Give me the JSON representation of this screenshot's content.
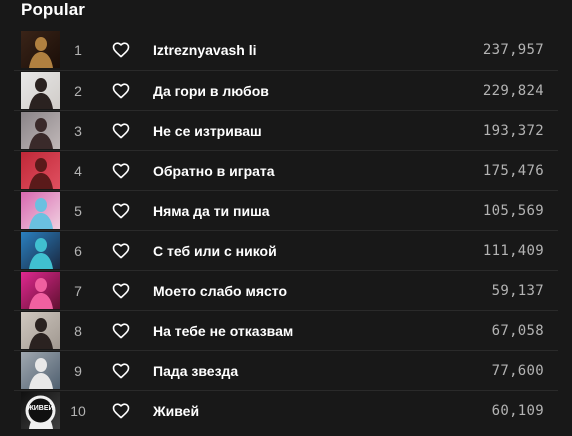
{
  "section": {
    "title": "Popular"
  },
  "tracks": [
    {
      "index": "1",
      "title": "Iztreznyavash li",
      "plays": "237,957",
      "thumb_colors": [
        "#3a2418",
        "#b08040",
        "#1a0e08"
      ]
    },
    {
      "index": "2",
      "title": "Да гори в любов",
      "plays": "229,824",
      "thumb_colors": [
        "#e8e8e8",
        "#2a2220",
        "#d0ccc8"
      ]
    },
    {
      "index": "3",
      "title": "Не се изтриваш",
      "plays": "193,372",
      "thumb_colors": [
        "#8a8488",
        "#3a2a2a",
        "#c0b8b8"
      ]
    },
    {
      "index": "4",
      "title": "Обратно в играта",
      "plays": "175,476",
      "thumb_colors": [
        "#c02838",
        "#5a1a1a",
        "#e05060"
      ]
    },
    {
      "index": "5",
      "title": "Няма да ти пиша",
      "plays": "105,569",
      "thumb_colors": [
        "#d868b0",
        "#6ac0e0",
        "#f0d0e0"
      ]
    },
    {
      "index": "6",
      "title": "С теб или с никой",
      "plays": "111,409",
      "thumb_colors": [
        "#2a80c0",
        "#40c0d0",
        "#1a2840"
      ]
    },
    {
      "index": "7",
      "title": "Моето слабо място",
      "plays": "59,137",
      "thumb_colors": [
        "#e02890",
        "#f060a0",
        "#601030"
      ]
    },
    {
      "index": "8",
      "title": "На тебе не отказвам",
      "plays": "67,058",
      "thumb_colors": [
        "#d0c8c0",
        "#2a2220",
        "#a09890"
      ]
    },
    {
      "index": "9",
      "title": "Пада звезда",
      "plays": "77,600",
      "thumb_colors": [
        "#a0a8b0",
        "#e8e8e8",
        "#506070"
      ]
    },
    {
      "index": "10",
      "title": "Живей",
      "plays": "60,109",
      "thumb_colors": [
        "#101010",
        "#f0f0f0",
        "#404040"
      ],
      "thumb_text": "ЖИВЕЙ"
    }
  ]
}
